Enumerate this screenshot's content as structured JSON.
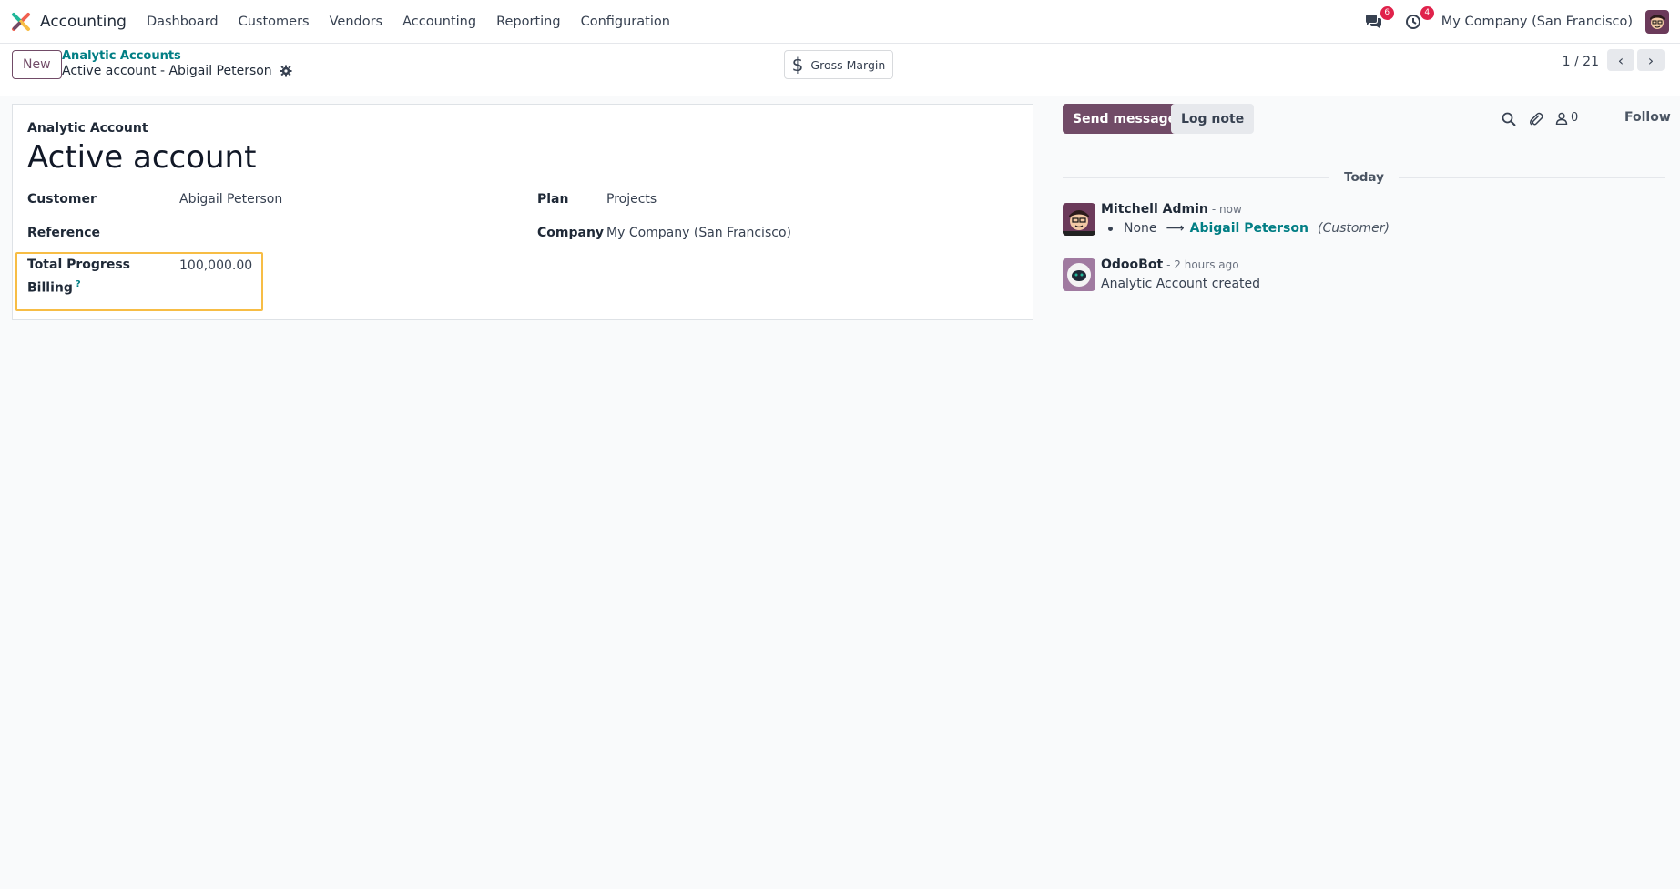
{
  "navbar": {
    "app_name": "Accounting",
    "menu": [
      "Dashboard",
      "Customers",
      "Vendors",
      "Accounting",
      "Reporting",
      "Configuration"
    ],
    "messages_badge": "6",
    "activities_badge": "4",
    "company": "My Company (San Francisco)",
    "icons": {
      "messages": "chat-bubbles-icon",
      "activities": "clock-icon",
      "logo": "odoo-logo-icon"
    }
  },
  "control_panel": {
    "new_label": "New",
    "breadcrumb_parent": "Analytic Accounts",
    "breadcrumb_current": "Active account - Abigail Peterson",
    "smart_button_label": "Gross Margin",
    "smart_button_icon": "$",
    "pager_value": "1 / 21",
    "pager_prev": "‹",
    "pager_next": "›"
  },
  "form": {
    "top_label": "Analytic Account",
    "title": "Active account",
    "fields": {
      "customer_label": "Customer",
      "customer_value": "Abigail Peterson",
      "reference_label": "Reference",
      "reference_value": "",
      "total_progress_label_line1": "Total Progress",
      "total_progress_label_line2": "Billing",
      "total_progress_help": "?",
      "total_progress_value": "100,000.00",
      "plan_label": "Plan",
      "plan_value": "Projects",
      "company_label": "Company",
      "company_value": "My Company (San Francisco)"
    },
    "highlight_color": "#f7bd45"
  },
  "chatter": {
    "send_message_label": "Send message",
    "log_note_label": "Log note",
    "followers_count": "0",
    "follow_label": "Follow",
    "date_separator": "Today",
    "messages": [
      {
        "author": "Mitchell Admin",
        "time": "- now",
        "tracking_old": "None",
        "tracking_arrow": "⟶",
        "tracking_new": "Abigail Peterson",
        "tracking_field": "(Customer)"
      },
      {
        "author": "OdooBot",
        "time": "- 2 hours ago",
        "body": "Analytic Account created"
      }
    ]
  },
  "colors": {
    "brand": "#714b67",
    "link": "#017e84",
    "badge": "#e0224b"
  }
}
